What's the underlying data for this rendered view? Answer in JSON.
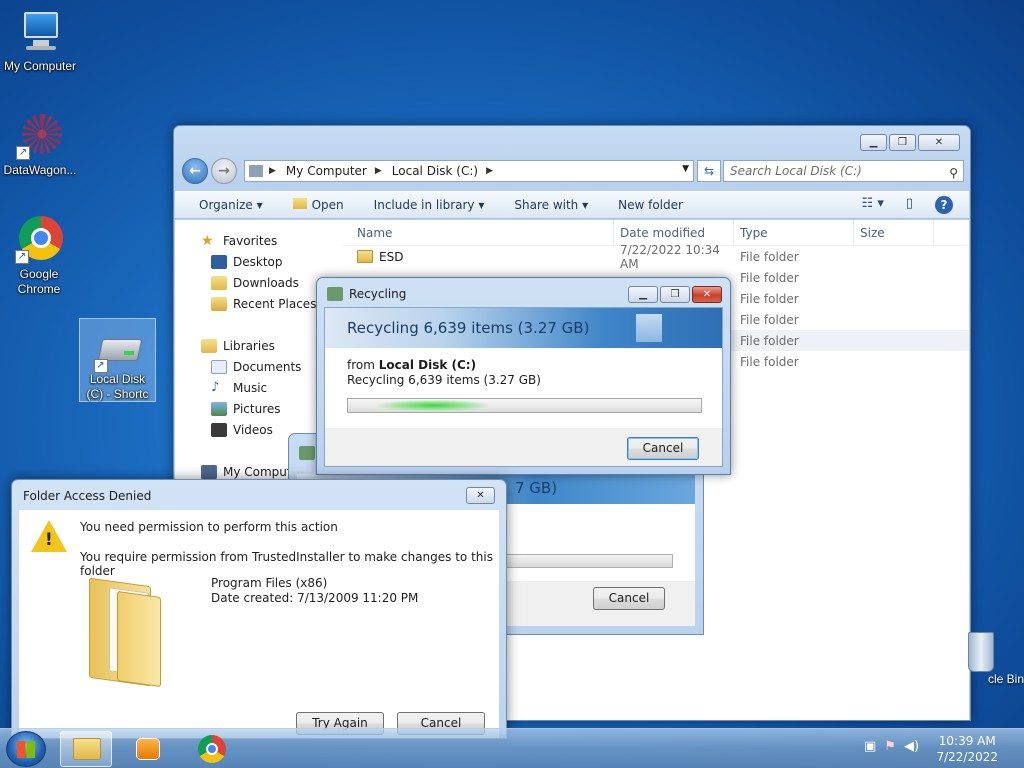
{
  "desktop": {
    "icons": [
      {
        "label": "My Computer"
      },
      {
        "label": "DataWagon..."
      },
      {
        "label": "Google Chrome"
      },
      {
        "label": "Local Disk (C) - Shortc"
      }
    ],
    "recycle_bin_label": "cle Bin"
  },
  "explorer": {
    "address": {
      "root": "My Computer",
      "current": "Local Disk (C:)"
    },
    "search_placeholder": "Search Local Disk (C:)",
    "toolbar": {
      "organize": "Organize",
      "open": "Open",
      "include_in_library": "Include in library",
      "share_with": "Share with",
      "new_folder": "New folder"
    },
    "nav": {
      "favorites": "Favorites",
      "desktop": "Desktop",
      "downloads": "Downloads",
      "recent_places": "Recent Places",
      "libraries": "Libraries",
      "documents": "Documents",
      "music": "Music",
      "pictures": "Pictures",
      "videos": "Videos",
      "computer": "My Compute"
    },
    "columns": {
      "name": "Name",
      "date": "Date modified",
      "type": "Type",
      "size": "Size"
    },
    "rows": [
      {
        "name": "ESD",
        "date": "7/22/2022 10:34 AM",
        "type": "File folder"
      },
      {
        "name": "",
        "date": "",
        "type": "File folder"
      },
      {
        "name": "",
        "date": "",
        "type": "File folder"
      },
      {
        "name": "",
        "date": "",
        "type": "File folder"
      },
      {
        "name": "",
        "date": "",
        "type": "File folder"
      },
      {
        "name": "",
        "date": "",
        "type": "File folder"
      }
    ]
  },
  "back_dialog": {
    "banner_fragment": "7 GB)",
    "cancel": "Cancel"
  },
  "recycling_dialog": {
    "title": "Recycling",
    "headline": "Recycling 6,639 items (3.27 GB)",
    "from_prefix": "from ",
    "from_location": "Local Disk (C:)",
    "detail": "Recycling 6,639 items (3.27 GB)",
    "cancel": "Cancel"
  },
  "access_denied": {
    "title": "Folder Access Denied",
    "line1": "You need permission to perform this action",
    "line2": "You require permission from TrustedInstaller to make changes to this folder",
    "folder_name": "Program Files (x86)",
    "date_created": "Date created: 7/13/2009 11:20 PM",
    "try_again": "Try Again",
    "cancel": "Cancel"
  },
  "taskbar": {
    "time": "10:39 AM",
    "date": "7/22/2022"
  }
}
